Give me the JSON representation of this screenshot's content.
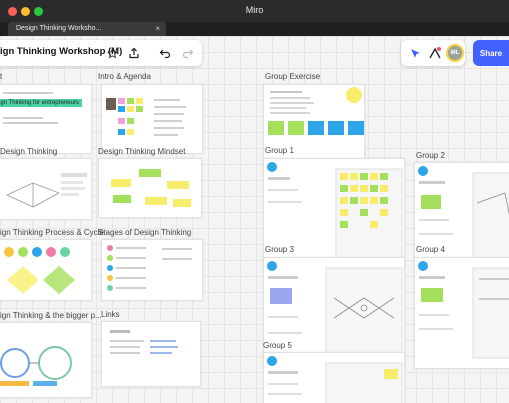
{
  "window": {
    "app_title": "Miro",
    "tab_title": "Design Thinking Worksho..."
  },
  "toolbar": {
    "board_title": "ign Thinking Workshop (M)",
    "share_label": "Share",
    "avatar_initials": "ML"
  },
  "sections": {
    "intro_agenda": "Intro & Agenda",
    "group_exercise": "Group Exercise",
    "design_thinking": "Design Thinking",
    "design_thinking_mindset": "Design Thinking Mindset",
    "group_1": "Group 1",
    "group_2": "Group 2",
    "process_cycle": "ign Thinking Process & Cycle",
    "stages": "Stages of Design Thinking",
    "group_3": "Group 3",
    "group_4": "Group 4",
    "bigger_picture": "ign Thinking & the bigger p...",
    "links": "Links",
    "group_5": "Group 5",
    "first_section_fragment": "t"
  },
  "frame_text": {
    "highlight": "sign Thinking for entrepreneurs"
  },
  "colors": {
    "share": "#4262ff",
    "highlight": "#4bd2a2",
    "sticky_yellow": "#f7ed6b",
    "sticky_green": "#a5e05d",
    "sticky_blue": "#2ca6e8",
    "sticky_pink": "#f0a0d8"
  }
}
